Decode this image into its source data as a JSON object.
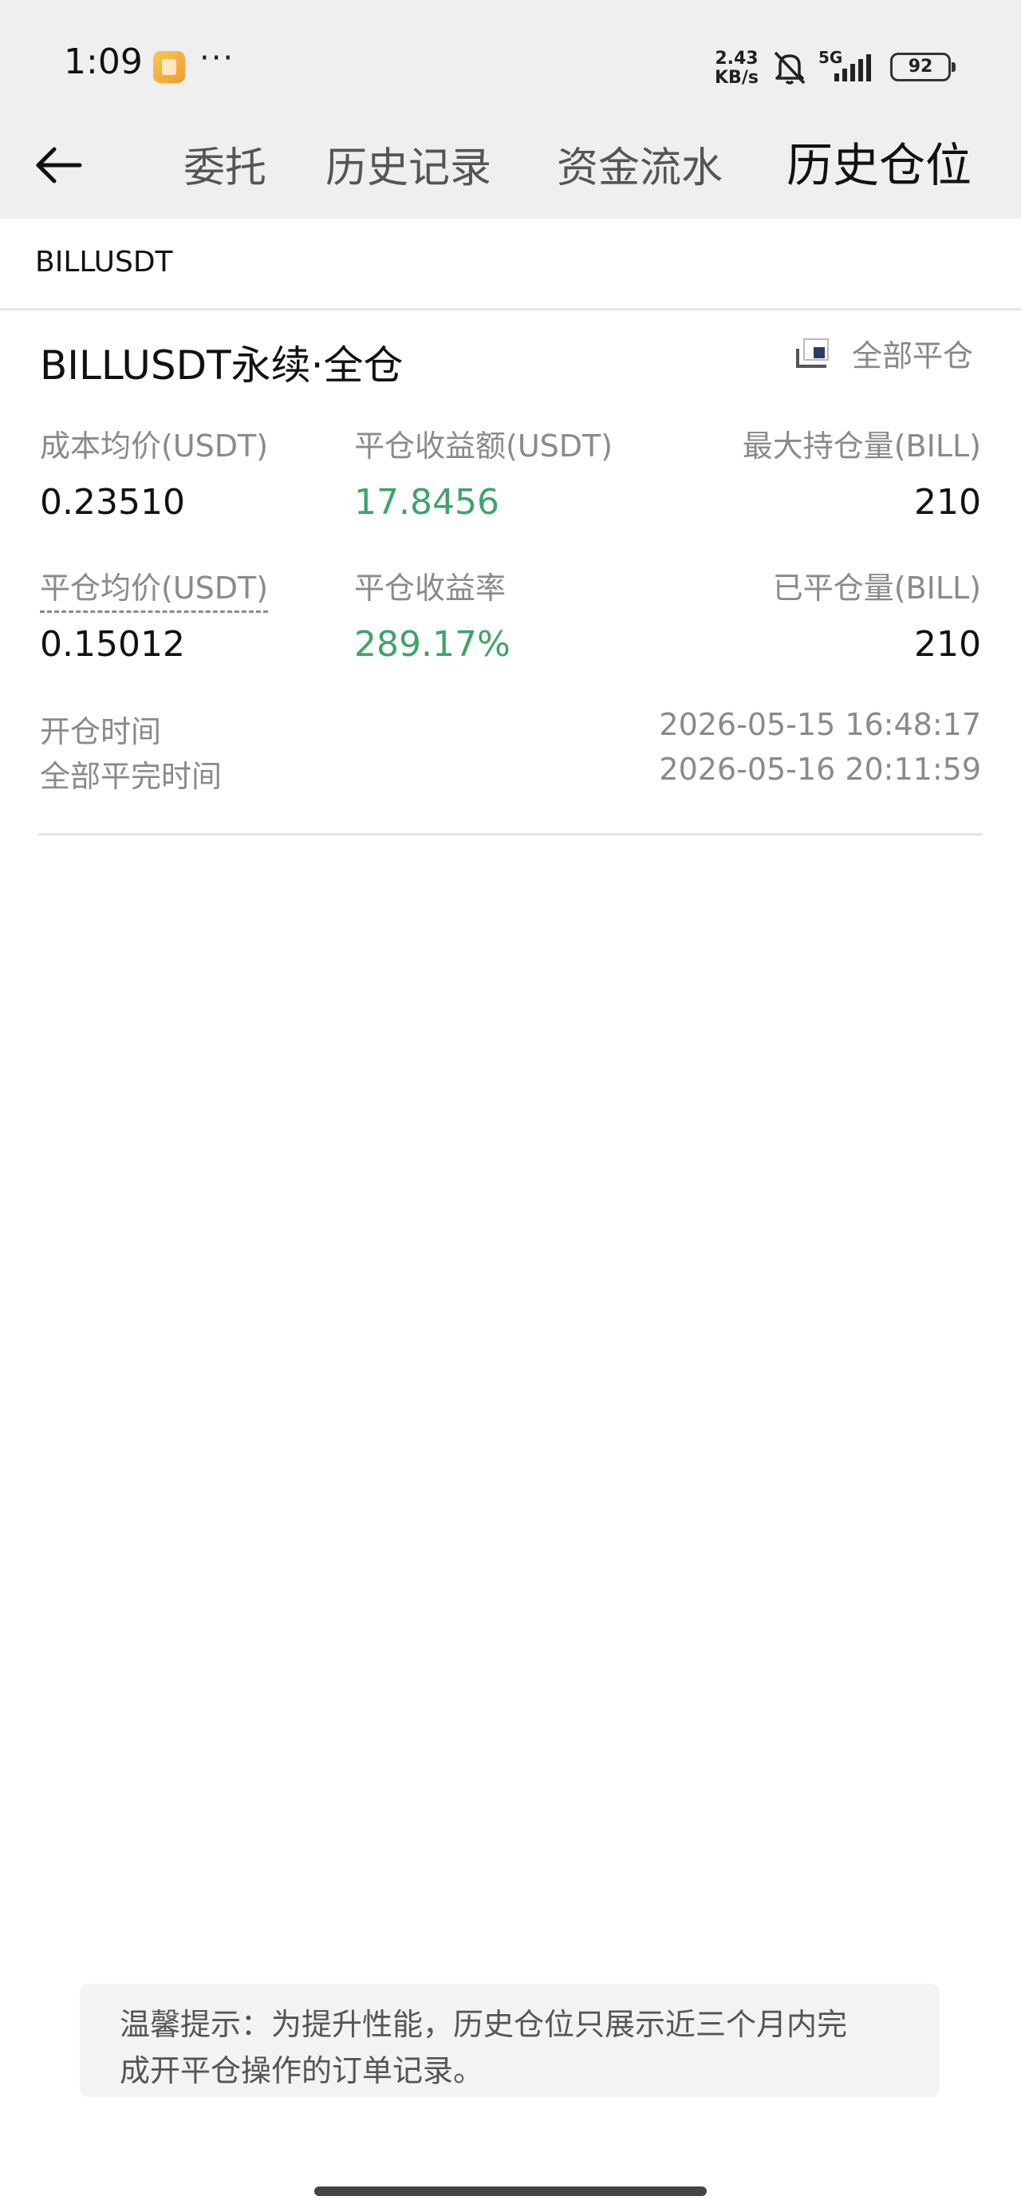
{
  "status_bar": {
    "time": "1:09",
    "more": "···",
    "net_speed_value": "2.43",
    "net_speed_unit": "KB/s",
    "network": "5G",
    "battery": "92"
  },
  "header": {
    "tabs": [
      {
        "label": "委托",
        "active": false
      },
      {
        "label": "历史记录",
        "active": false
      },
      {
        "label": "资金流水",
        "active": false
      },
      {
        "label": "历史仓位",
        "active": true
      }
    ]
  },
  "filter": {
    "symbol": "BILLUSDT"
  },
  "position": {
    "title": "BILLUSDT永续·全仓",
    "close_all_label": "全部平仓",
    "fields": {
      "cost_avg_label": "成本均价(USDT)",
      "cost_avg_value": "0.23510",
      "close_pnl_label": "平仓收益额(USDT)",
      "close_pnl_value": "17.8456",
      "max_position_label": "最大持仓量(BILL)",
      "max_position_value": "210",
      "close_avg_label": "平仓均价(USDT)",
      "close_avg_value": "0.15012",
      "close_roi_label": "平仓收益率",
      "close_roi_value": "289.17%",
      "closed_qty_label": "已平仓量(BILL)",
      "closed_qty_value": "210"
    },
    "open_time_label": "开仓时间",
    "open_time_value": "2026-05-15 16:48:17",
    "full_close_time_label": "全部平完时间",
    "full_close_time_value": "2026-05-16 20:11:59"
  },
  "tip": {
    "line1": "温馨提示：为提升性能，历史仓位只展示近三个月内完",
    "line2": "成开平仓操作的订单记录。"
  },
  "colors": {
    "profit_green": "#3fa36a",
    "header_bg": "#efefef",
    "muted_text": "#8a8a8a"
  },
  "icons": {
    "back": "arrow-left-icon",
    "close_all": "close-position-icon",
    "mute": "bell-off-icon",
    "signal": "signal-bars-icon",
    "battery": "battery-icon"
  }
}
